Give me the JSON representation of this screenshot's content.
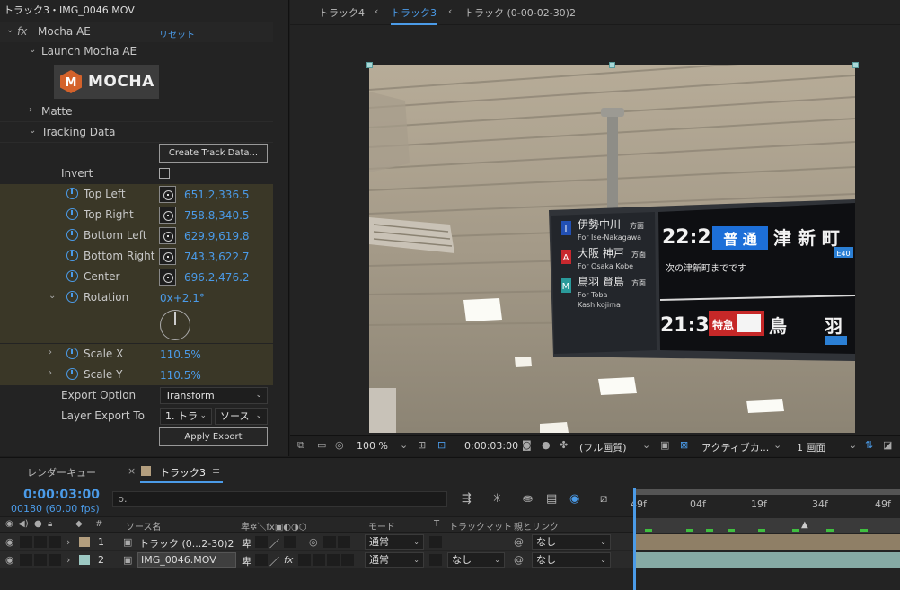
{
  "effect_panel": {
    "title": "トラック3・IMG_0046.MOV",
    "effect_name": "Mocha AE",
    "reset_label": "リセット",
    "launch_label": "Launch Mocha AE",
    "logo_text": "MOCHA",
    "matte_label": "Matte",
    "tracking_data_label": "Tracking Data",
    "create_track_button": "Create Track Data...",
    "invert_label": "Invert",
    "points": [
      {
        "label": "Top Left",
        "value": "651.2,336.5"
      },
      {
        "label": "Top Right",
        "value": "758.8,340.5"
      },
      {
        "label": "Bottom Left",
        "value": "629.9,619.8"
      },
      {
        "label": "Bottom Right",
        "value": "743.3,622.7"
      },
      {
        "label": "Center",
        "value": "696.2,476.2"
      }
    ],
    "rotation_label": "Rotation",
    "rotation_value": "0x+2.1°",
    "scale_x_label": "Scale X",
    "scale_x_value": "110.5%",
    "scale_y_label": "Scale Y",
    "scale_y_value": "110.5%",
    "export_option_label": "Export Option",
    "export_option_value": "Transform",
    "layer_export_label": "Layer Export To",
    "layer_export_value": "1. トラ",
    "layer_export_source": "ソース",
    "apply_export_button": "Apply Export"
  },
  "viewer": {
    "tabs": [
      "トラック4",
      "トラック3",
      "トラック (0-00-02-30)2"
    ],
    "active_tab": "トラック3",
    "zoom": "100 %",
    "timecode": "0:00:03:00",
    "resolution": "(フル画質)",
    "camera": "アクティブカ...",
    "views": "1 画面"
  },
  "video_signs": {
    "route1": "伊勢中川",
    "route1_suffix": "方面",
    "route1_en": "For Ise-Nakagawa",
    "route2": "大阪 神戸",
    "route2_suffix": "方面",
    "route2_en": "For Osaka Kobe",
    "route3": "鳥羽 賢島",
    "route3_suffix": "方面",
    "route3_en1": "For Toba",
    "route3_en2": "Kashikojima",
    "badge1": "I",
    "badge2": "A",
    "badge3": "M",
    "time1": "22:22",
    "type1": "普 通",
    "dest1": "津 新 町",
    "code1": "E40",
    "note1": "次の津新町までです",
    "time2": "21:35",
    "type2": "特急",
    "dest2a": "鳥",
    "dest2b": "羽"
  },
  "timeline": {
    "tabs": [
      "レンダーキュー",
      "トラック3"
    ],
    "timecode": "0:00:03:00",
    "frames": "00180 (60.00 fps)",
    "search_placeholder": "ρ.",
    "headers": {
      "num": "#",
      "source": "ソース名",
      "mode": "モード",
      "t": "T",
      "trackmatte": "トラックマット",
      "parent": "親とリンク"
    },
    "ruler": [
      "49f",
      "04f",
      "19f",
      "34f",
      "49f"
    ],
    "layers": [
      {
        "num": "1",
        "name": "トラック (0...2-30)2",
        "mode": "通常",
        "trackmatte": "",
        "parent": "なし",
        "swatch": "#b39e7e"
      },
      {
        "num": "2",
        "name": "IMG_0046.MOV",
        "mode": "通常",
        "trackmatte": "なし",
        "parent": "なし",
        "swatch": "#9cc8c2"
      }
    ]
  }
}
